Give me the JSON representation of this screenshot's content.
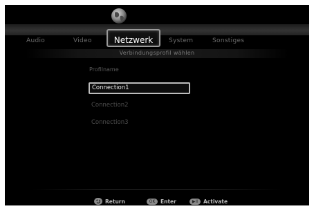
{
  "tabs": [
    {
      "label": "Audio"
    },
    {
      "label": "Video"
    },
    {
      "label": "Netzwerk",
      "active": true
    },
    {
      "label": "System"
    },
    {
      "label": "Sonstiges"
    }
  ],
  "subtitle": "Verbindungsprofil wählen",
  "section_title": "Profilname",
  "profiles": [
    {
      "label": "Connection1",
      "selected": true
    },
    {
      "label": "Connection2"
    },
    {
      "label": "Connection3"
    }
  ],
  "footer": {
    "return": {
      "label": "Return",
      "icon": "return-arrow-icon"
    },
    "enter": {
      "key": "OK",
      "label": "Enter"
    },
    "activate": {
      "key": "▶II",
      "label": "Activate"
    }
  },
  "colors": {
    "background": "#000000",
    "text_active": "#ffffff",
    "text_inactive": "#6b6b6b",
    "selection_border": "#bdbdbd"
  },
  "icons": {
    "network_tab": "globe-icon"
  }
}
